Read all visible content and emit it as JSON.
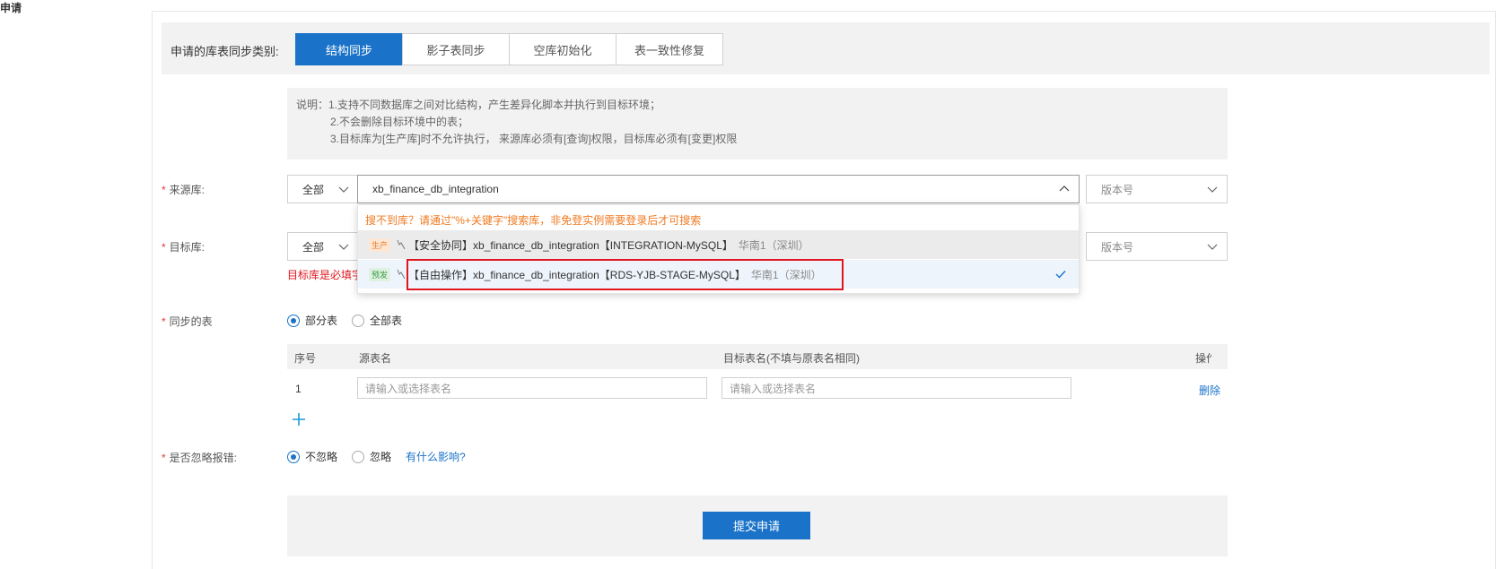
{
  "page": {
    "title": "申请"
  },
  "sync_type": {
    "label": "申请的库表同步类别:",
    "tabs": [
      "结构同步",
      "影子表同步",
      "空库初始化",
      "表一致性修复"
    ],
    "active_index": 0
  },
  "description": {
    "lines": [
      "说明：1.支持不同数据库之间对比结构，产生差异化脚本并执行到目标环境；",
      "2.不会删除目标环境中的表；",
      "3.目标库为[生产库]时不允许执行， 来源库必须有[查询]权限，目标库必须有[变更]权限"
    ]
  },
  "source_db": {
    "required_mark": "*",
    "label": "来源库:",
    "env_filter": "全部",
    "value": "xb_finance_db_integration",
    "version_placeholder": "版本号"
  },
  "target_db": {
    "required_mark": "*",
    "label": "目标库:",
    "env_filter": "全部",
    "version_placeholder": "版本号",
    "error": "目标库是必填字段"
  },
  "dropdown": {
    "hint": "搜不到库？请通过\"%+关键字\"搜索库，非免登实例需要登录后才可搜索",
    "items": [
      {
        "env": "生产",
        "text": "【安全协同】xb_finance_db_integration【INTEGRATION-MySQL】",
        "region": "华南1（深圳）",
        "selected": false
      },
      {
        "env": "预发",
        "text": "【自由操作】xb_finance_db_integration【RDS-YJB-STAGE-MySQL】",
        "region": "华南1（深圳）",
        "selected": true
      }
    ]
  },
  "sync_tables": {
    "required_mark": "*",
    "label": "同步的表",
    "options": [
      "部分表",
      "全部表"
    ],
    "selected": "部分表",
    "columns": [
      "序号",
      "源表名",
      "目标表名(不填与原表名相同)",
      "操作"
    ],
    "rows": [
      {
        "index": "1",
        "source_placeholder": "请输入或选择表名",
        "target_placeholder": "请输入或选择表名",
        "action": "删除"
      }
    ]
  },
  "ignore_errors": {
    "required_mark": "*",
    "label": "是否忽略报错:",
    "options": [
      "不忽略",
      "忽略"
    ],
    "selected": "不忽略",
    "help_link": "有什么影响?"
  },
  "submit": {
    "label": "提交申请"
  },
  "colors": {
    "primary": "#1a73c8",
    "error": "#e0161e",
    "hint": "#f07a21"
  },
  "icons": [
    "chevron-down-icon",
    "chevron-up-icon",
    "connection-icon",
    "check-icon",
    "plus-icon"
  ]
}
